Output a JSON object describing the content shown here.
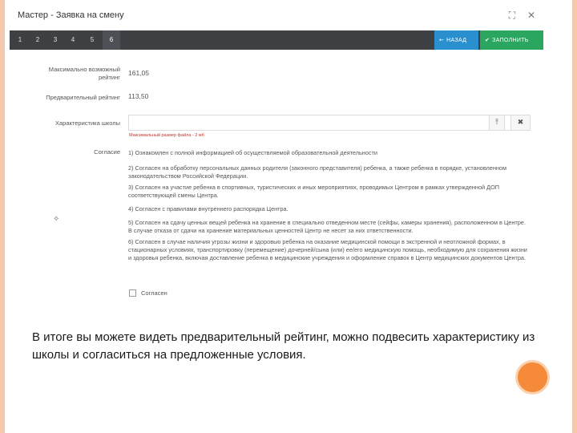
{
  "window": {
    "title": "Мастер - Заявка на смену",
    "maximize_icon": "maximize-icon",
    "close_icon": "close-icon"
  },
  "stepper": {
    "steps": [
      "1",
      "2",
      "3",
      "4",
      "5",
      "6"
    ],
    "active_step": "6",
    "back_label": "НАЗАД",
    "save_label": "ЗАПОЛНИТЬ"
  },
  "form": {
    "max_rating_label": "Максимально возможный рейтинг",
    "max_rating_value": "161,05",
    "prelim_rating_label": "Предварительный рейтинг",
    "prelim_rating_value": "113,50",
    "characteristics_label": "Характеристика школы",
    "file_hint": "Максимальный размер файла - 2 мб",
    "consent_label": "Согласие",
    "consents": [
      "1) Ознакомлен с полной информацией об осуществляемой образовательной деятельности",
      "2) Согласен на обработку персональных данных родителя (законного представителя) ребенка, а также ребенка в порядке, установленном законодательством Российской Федерации.",
      "3) Согласен на участие ребенка в спортивных, туристических и иных мероприятиях, проводимых Центром в рамках утвержденной ДОП соответствующей смены Центра.",
      "4) Согласен с правилами внутреннего распорядка Центра.",
      "5) Согласен на сдачу ценных вещей ребенка на хранение в специально отведенном месте (сейфы, камеры хранения), расположенном в Центре. В случае отказа от сдачи на хранение материальных ценностей Центр не несет за них ответственности.",
      "6) Согласен в случае наличия угрозы жизни и здоровью ребенка на оказание медицинской помощи в экстренной и неотложной формах, в стационарных условиях, транспортировку (перемещение) дочерней/сына (или) ее/его медицинскую помощь, необходимую для сохранения жизни и здоровья ребенка, включая доставление ребенка в медицинские учреждения и оформление справок в Центр медицинских документов Центра."
    ],
    "agree_label": "Согласен"
  },
  "caption": "В итоге вы можете видеть предварительный рейтинг, можно подвесить характеристику из школы и согласиться на предложенные условия.",
  "colors": {
    "stepper_bg": "#3e4044",
    "back_btn": "#2a8fcf",
    "save_btn": "#2aa660",
    "accent_dot": "#f58a3a",
    "slide_border": "#f5c9ae"
  }
}
